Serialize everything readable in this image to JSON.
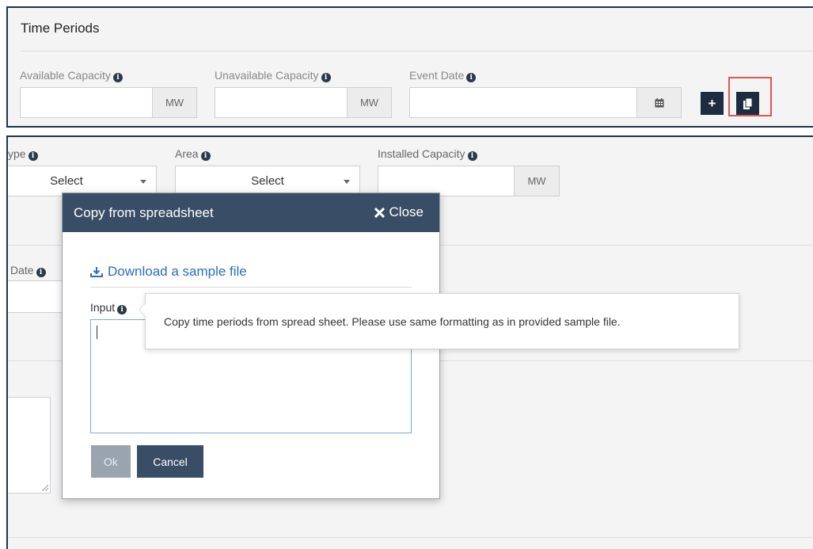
{
  "time_periods": {
    "title": "Time Periods",
    "available_capacity": {
      "label": "Available Capacity",
      "value": "",
      "unit": "MW"
    },
    "unavailable_capacity": {
      "label": "Unavailable Capacity",
      "value": "",
      "unit": "MW"
    },
    "event_date": {
      "label": "Event Date",
      "value": ""
    },
    "add_button": "+",
    "highlight_color": "#e05656"
  },
  "background_form": {
    "type": {
      "label": "ype",
      "value": "Select"
    },
    "area": {
      "label": "Area",
      "value": "Select"
    },
    "installed_capacity": {
      "label": "Installed Capacity",
      "value": "",
      "unit": "MW"
    },
    "date": {
      "label": "Date"
    }
  },
  "modal": {
    "title": "Copy from spreadsheet",
    "close_label": "Close",
    "download_link": "Download a sample file",
    "input_label": "Input",
    "input_value": "",
    "ok_label": "Ok",
    "cancel_label": "Cancel",
    "header_color": "#3a4d66"
  },
  "tooltip": {
    "text": "Copy time periods from spread sheet. Please use same formatting as in provided sample file."
  }
}
